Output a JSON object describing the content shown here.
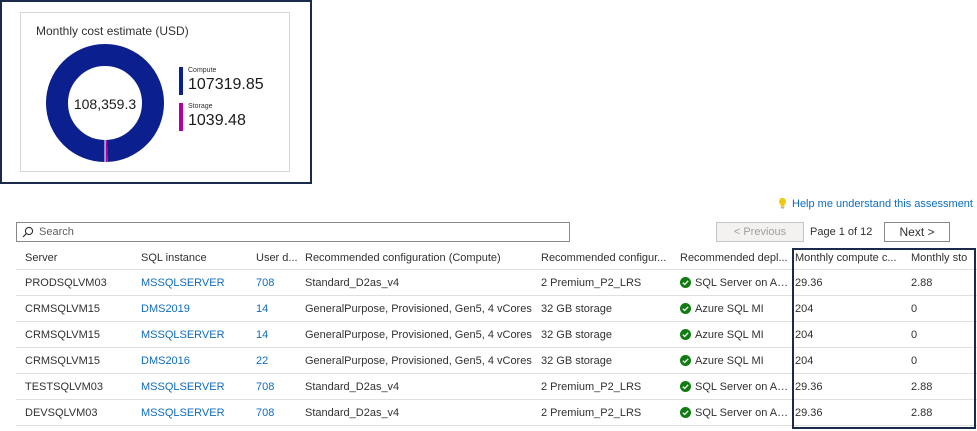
{
  "cost_card": {
    "title": "Monthly cost estimate (USD)",
    "total": "108,359.3",
    "compute": {
      "label": "Compute",
      "value": "107319.85",
      "color": "#0b1f8f"
    },
    "storage": {
      "label": "Storage",
      "value": "1039.48",
      "color": "#b4009e"
    }
  },
  "help": {
    "label": "Help me understand this assessment",
    "icon": "lightbulb-icon"
  },
  "search": {
    "placeholder": "Search",
    "icon": "search-icon"
  },
  "pager": {
    "previous_label": "< Previous",
    "page_info": "Page 1 of 12",
    "next_label": "Next >"
  },
  "table": {
    "headers": [
      "Server",
      "SQL instance",
      "User d...",
      "Recommended configuration (Compute)",
      "Recommended configur...",
      "Recommended depl...",
      "Monthly compute c...",
      "Monthly sto"
    ],
    "rows": [
      {
        "server": "PRODSQLVM03",
        "instance": "MSSQLSERVER",
        "user": "708",
        "compute_config": "Standard_D2as_v4",
        "storage_config": "2 Premium_P2_LRS",
        "deployment": "SQL Server on Az...",
        "compute_cost": "29.36",
        "storage_cost": "2.88"
      },
      {
        "server": "CRMSQLVM15",
        "instance": "DMS2019",
        "user": "14",
        "compute_config": "GeneralPurpose, Provisioned, Gen5, 4 vCores",
        "storage_config": "32 GB storage",
        "deployment": "Azure SQL MI",
        "compute_cost": "204",
        "storage_cost": "0"
      },
      {
        "server": "CRMSQLVM15",
        "instance": "MSSQLSERVER",
        "user": "14",
        "compute_config": "GeneralPurpose, Provisioned, Gen5, 4 vCores",
        "storage_config": "32 GB storage",
        "deployment": "Azure SQL MI",
        "compute_cost": "204",
        "storage_cost": "0"
      },
      {
        "server": "CRMSQLVM15",
        "instance": "DMS2016",
        "user": "22",
        "compute_config": "GeneralPurpose, Provisioned, Gen5, 4 vCores",
        "storage_config": "32 GB storage",
        "deployment": "Azure SQL MI",
        "compute_cost": "204",
        "storage_cost": "0"
      },
      {
        "server": "TESTSQLVM03",
        "instance": "MSSQLSERVER",
        "user": "708",
        "compute_config": "Standard_D2as_v4",
        "storage_config": "2 Premium_P2_LRS",
        "deployment": "SQL Server on Az...",
        "compute_cost": "29.36",
        "storage_cost": "2.88"
      },
      {
        "server": "DEVSQLVM03",
        "instance": "MSSQLSERVER",
        "user": "708",
        "compute_config": "Standard_D2as_v4",
        "storage_config": "2 Premium_P2_LRS",
        "deployment": "SQL Server on Az...",
        "compute_cost": "29.36",
        "storage_cost": "2.88"
      }
    ]
  },
  "colors": {
    "accent": "#0f6cbd",
    "success": "#107c10",
    "highlight_border": "#1c2a4a"
  }
}
